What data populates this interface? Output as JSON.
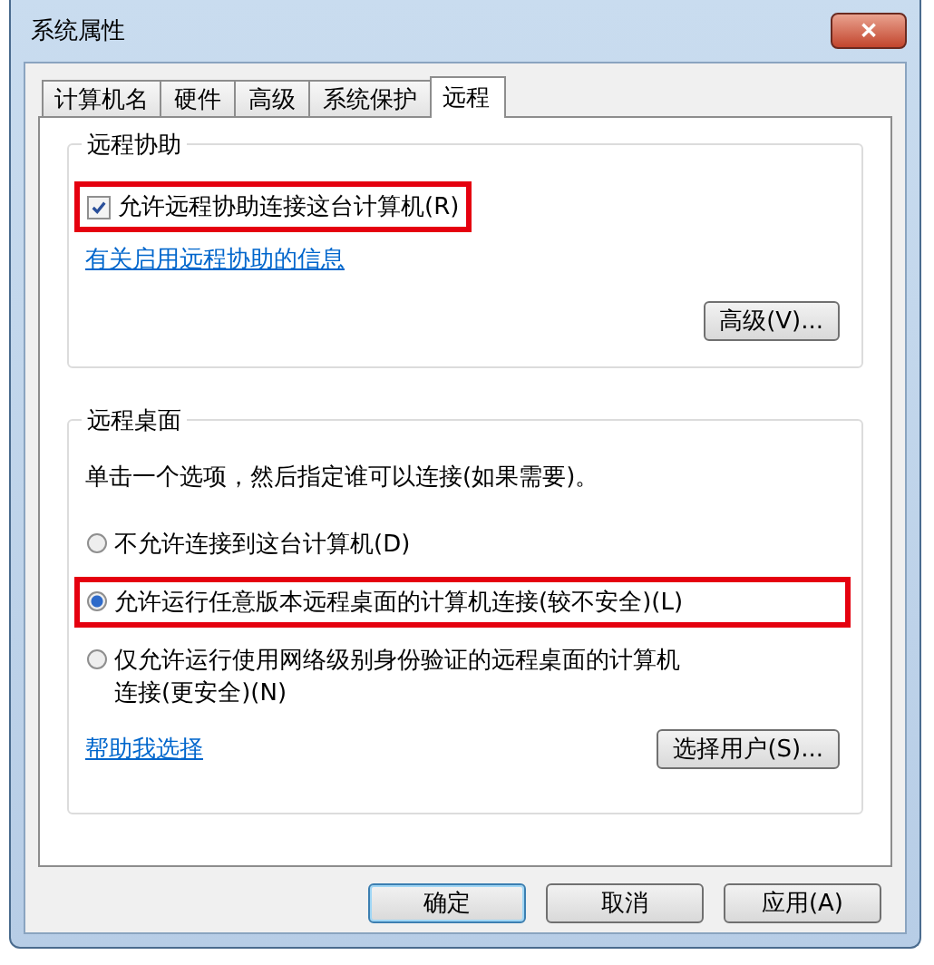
{
  "window": {
    "title": "系统属性",
    "close": "✕"
  },
  "tabs": [
    {
      "label": "计算机名",
      "selected": false
    },
    {
      "label": "硬件",
      "selected": false
    },
    {
      "label": "高级",
      "selected": false
    },
    {
      "label": "系统保护",
      "selected": false
    },
    {
      "label": "远程",
      "selected": true
    }
  ],
  "remote_assistance": {
    "title": "远程协助",
    "checkbox": {
      "label": "允许远程协助连接这台计算机(R)",
      "checked": true,
      "highlighted": true
    },
    "link": "有关启用远程协助的信息",
    "button": "高级(V)..."
  },
  "remote_desktop": {
    "title": "远程桌面",
    "hint": "单击一个选项，然后指定谁可以连接(如果需要)。",
    "options": [
      {
        "label": "不允许连接到这台计算机(D)",
        "selected": false,
        "highlighted": false
      },
      {
        "label": "允许运行任意版本远程桌面的计算机连接(较不安全)(L)",
        "selected": true,
        "highlighted": true
      },
      {
        "label": "仅允许运行使用网络级别身份验证的远程桌面的计算机连接(更安全)(N)",
        "selected": false,
        "highlighted": false
      }
    ],
    "link": "帮助我选择",
    "button": "选择用户(S)..."
  },
  "buttons": [
    {
      "label": "确定",
      "default": true
    },
    {
      "label": "取消",
      "default": false
    },
    {
      "label": "应用(A)",
      "default": false
    }
  ]
}
